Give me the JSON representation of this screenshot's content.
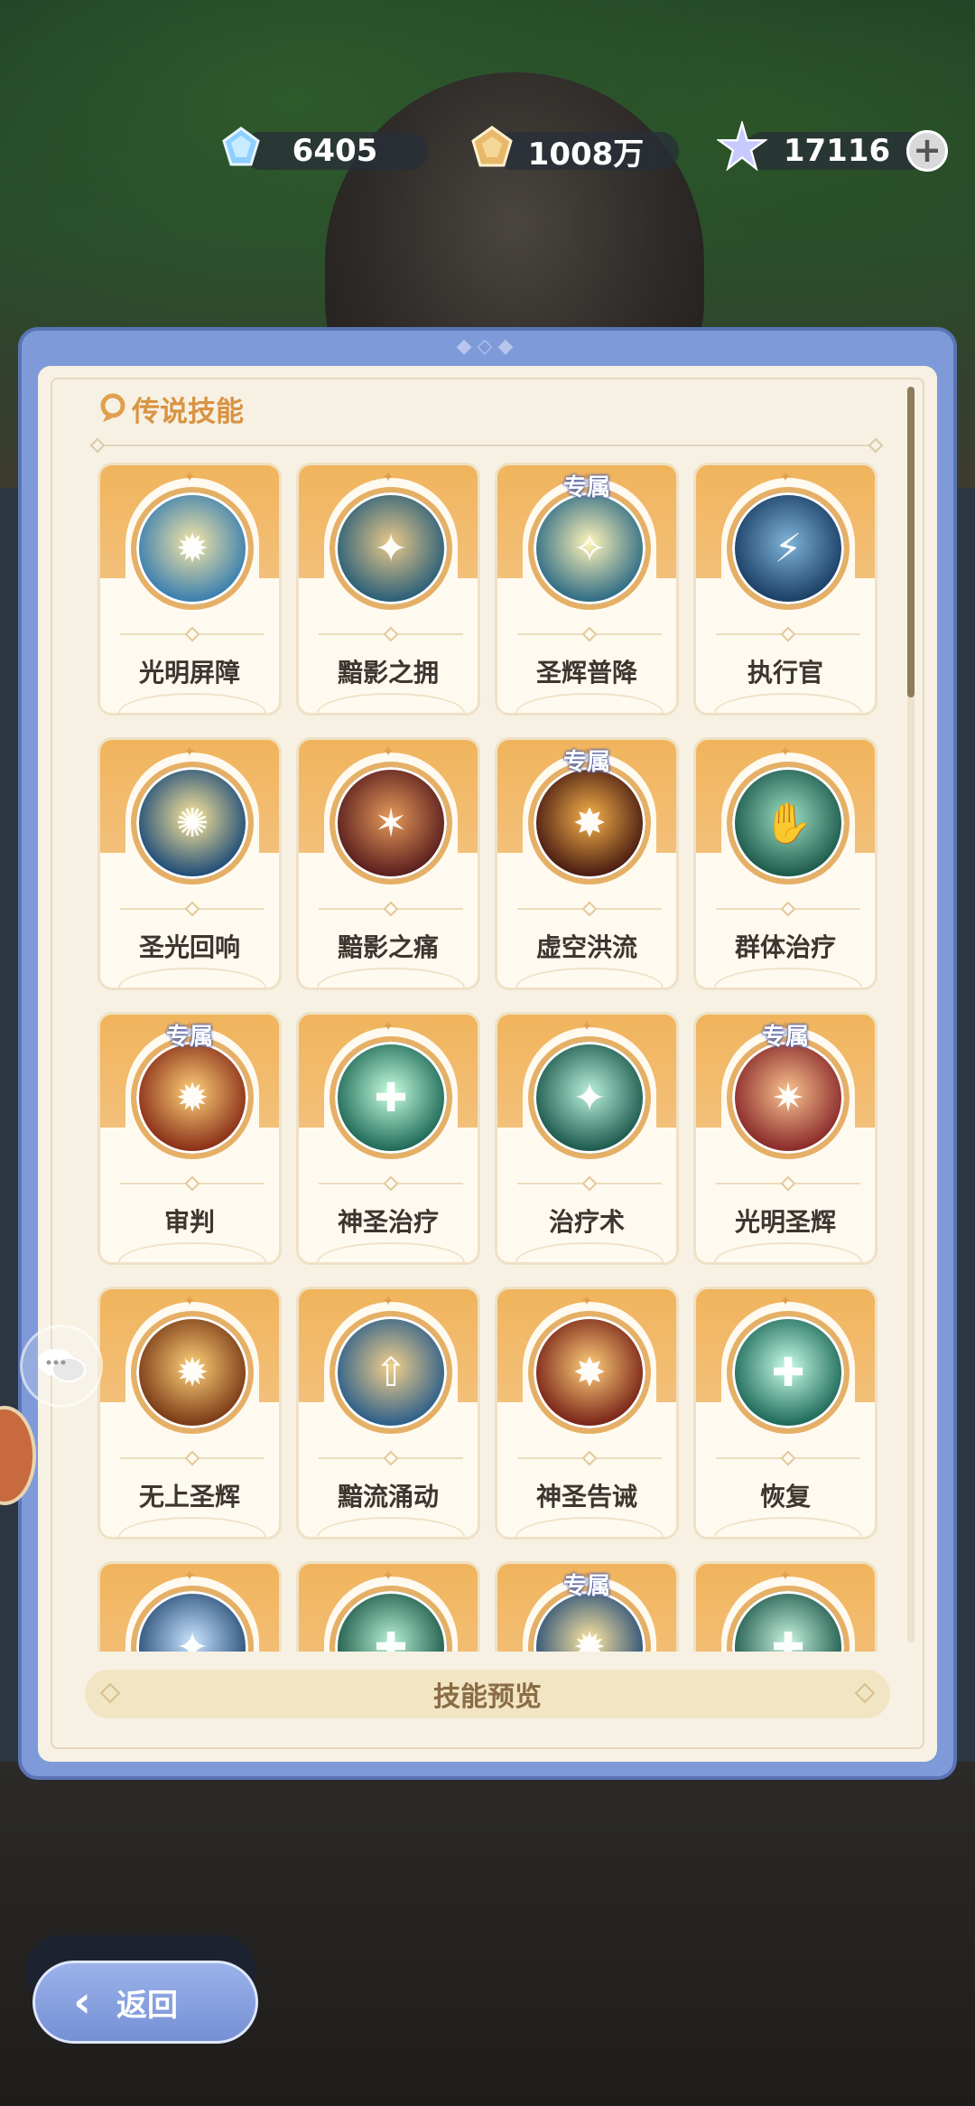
{
  "currencies": [
    {
      "icon": "diamond-icon",
      "value": "6405",
      "color": "#8ecfff"
    },
    {
      "icon": "gold-coin-icon",
      "value": "1008万",
      "color": "#e8b96a"
    },
    {
      "icon": "star-crystal-icon",
      "value": "17116",
      "color": "#c7c9ff"
    }
  ],
  "section_title": "传说技能",
  "exclusive_label": "专属",
  "skills": [
    {
      "name": "光明屏障",
      "exclusive": false,
      "icon": "light-barrier-icon",
      "colors": [
        "#f7e6a5",
        "#3a7fb0"
      ],
      "glyph": "✹"
    },
    {
      "name": "黯影之拥",
      "exclusive": false,
      "icon": "shadow-embrace-icon",
      "colors": [
        "#e9c98a",
        "#2b5f78"
      ],
      "glyph": "✦"
    },
    {
      "name": "圣辉普降",
      "exclusive": true,
      "icon": "holy-rain-icon",
      "colors": [
        "#fff4b8",
        "#2f6c85"
      ],
      "glyph": "✧"
    },
    {
      "name": "执行官",
      "exclusive": false,
      "icon": "executor-staff-icon",
      "colors": [
        "#7fb3d8",
        "#1b3f66"
      ],
      "glyph": "⚡"
    },
    {
      "name": "圣光回响",
      "exclusive": false,
      "icon": "holy-echo-icon",
      "colors": [
        "#ffe99a",
        "#1f4d78"
      ],
      "glyph": "✺"
    },
    {
      "name": "黯影之痛",
      "exclusive": false,
      "icon": "shadow-pain-icon",
      "colors": [
        "#e69a5a",
        "#5a1e1e"
      ],
      "glyph": "✶"
    },
    {
      "name": "虚空洪流",
      "exclusive": true,
      "icon": "void-torrent-icon",
      "colors": [
        "#f6b24a",
        "#4a1c12"
      ],
      "glyph": "✸"
    },
    {
      "name": "群体治疗",
      "exclusive": false,
      "icon": "group-heal-icon",
      "colors": [
        "#9ee0c4",
        "#1d5a4c"
      ],
      "glyph": "✋"
    },
    {
      "name": "审判",
      "exclusive": true,
      "icon": "judgment-icon",
      "colors": [
        "#ffd27a",
        "#8a2f18"
      ],
      "glyph": "✹"
    },
    {
      "name": "神圣治疗",
      "exclusive": false,
      "icon": "divine-heal-icon",
      "colors": [
        "#c8ffe0",
        "#1f6a58"
      ],
      "glyph": "✚"
    },
    {
      "name": "治疗术",
      "exclusive": false,
      "icon": "heal-spell-icon",
      "colors": [
        "#b9f0db",
        "#1d5a4e"
      ],
      "glyph": "✦"
    },
    {
      "name": "光明圣辉",
      "exclusive": true,
      "icon": "holy-radiance-icon",
      "colors": [
        "#f9c38f",
        "#8a2a2a"
      ],
      "glyph": "✷"
    },
    {
      "name": "无上圣辉",
      "exclusive": false,
      "icon": "supreme-radiance-icon",
      "colors": [
        "#ffd27a",
        "#7a3a16"
      ],
      "glyph": "✹"
    },
    {
      "name": "黯流涌动",
      "exclusive": false,
      "icon": "dark-surge-icon",
      "colors": [
        "#f3d08a",
        "#2d5f8a"
      ],
      "glyph": "⇧"
    },
    {
      "name": "神圣告诫",
      "exclusive": false,
      "icon": "divine-warning-icon",
      "colors": [
        "#ffd07a",
        "#7a2418"
      ],
      "glyph": "✸"
    },
    {
      "name": "恢复",
      "exclusive": false,
      "icon": "restore-icon",
      "colors": [
        "#c8ffe8",
        "#1f6a5a"
      ],
      "glyph": "✚"
    },
    {
      "name": "",
      "exclusive": false,
      "icon": "frost-skill-icon",
      "colors": [
        "#c9e4ff",
        "#2a4f7a"
      ],
      "glyph": "✦"
    },
    {
      "name": "",
      "exclusive": false,
      "icon": "nature-skill-icon",
      "colors": [
        "#b6f0d4",
        "#1e5a4a"
      ],
      "glyph": "✚"
    },
    {
      "name": "",
      "exclusive": true,
      "icon": "sun-skill-icon",
      "colors": [
        "#ffe8a0",
        "#2a4f78"
      ],
      "glyph": "✹"
    },
    {
      "name": "",
      "exclusive": false,
      "icon": "cross-skill-icon",
      "colors": [
        "#c8f5e0",
        "#1f5a4c"
      ],
      "glyph": "✚"
    }
  ],
  "preview_label": "技能预览",
  "back_label": "返回"
}
